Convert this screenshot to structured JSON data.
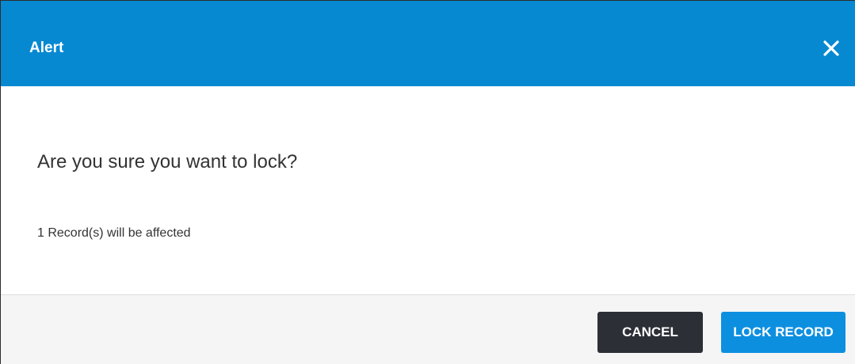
{
  "dialog": {
    "title": "Alert",
    "close_icon": "close-icon",
    "question": "Are you sure you want to lock?",
    "affected_text": "1 Record(s) will be affected"
  },
  "footer": {
    "cancel_label": "CANCEL",
    "confirm_label": "LOCK RECORD"
  },
  "colors": {
    "header_bg": "#0789d2",
    "cancel_bg": "#2c2f36",
    "confirm_bg": "#0d8fe0",
    "footer_bg": "#f5f5f5"
  }
}
